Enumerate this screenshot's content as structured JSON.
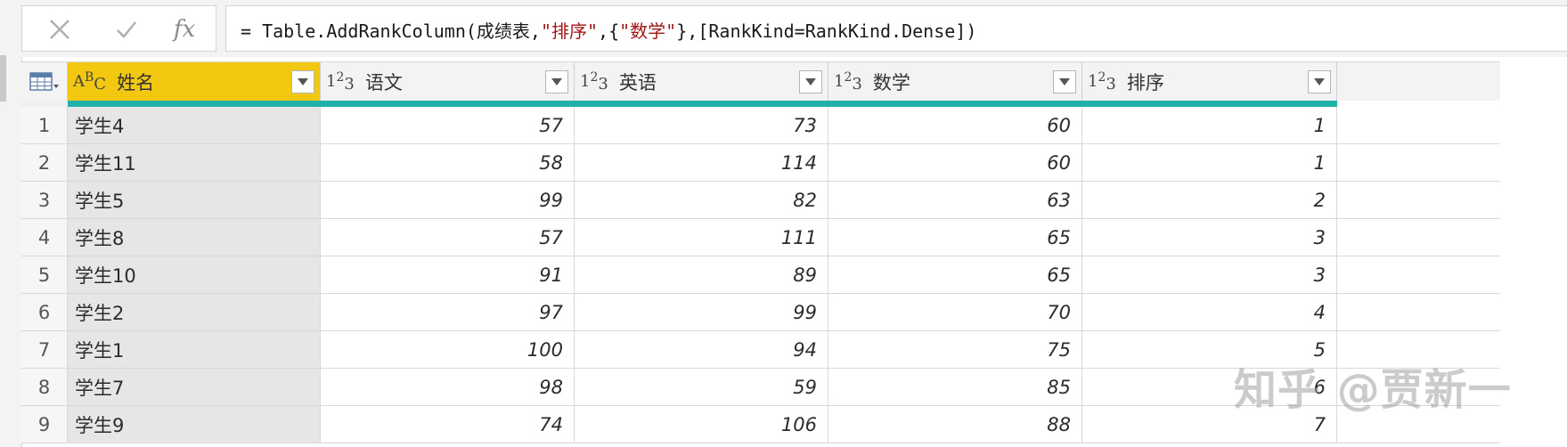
{
  "formula_bar": {
    "cancel_icon": "close-x",
    "commit_icon": "checkmark",
    "fx_label": "fx",
    "formula_prefix": "= Table.AddRankColumn(成绩表,",
    "formula_str1": "\"排序\"",
    "formula_mid": ",{",
    "formula_str2": "\"数学\"",
    "formula_suffix": "},[RankKind=RankKind.Dense])"
  },
  "table": {
    "columns": [
      {
        "label": "姓名",
        "type": "text"
      },
      {
        "label": "语文",
        "type": "number"
      },
      {
        "label": "英语",
        "type": "number"
      },
      {
        "label": "数学",
        "type": "number"
      },
      {
        "label": "排序",
        "type": "number"
      }
    ],
    "rows": [
      {
        "idx": "1",
        "name": "学生4",
        "yuwen": "57",
        "yingyu": "73",
        "shuxue": "60",
        "paixu": "1"
      },
      {
        "idx": "2",
        "name": "学生11",
        "yuwen": "58",
        "yingyu": "114",
        "shuxue": "60",
        "paixu": "1"
      },
      {
        "idx": "3",
        "name": "学生5",
        "yuwen": "99",
        "yingyu": "82",
        "shuxue": "63",
        "paixu": "2"
      },
      {
        "idx": "4",
        "name": "学生8",
        "yuwen": "57",
        "yingyu": "111",
        "shuxue": "65",
        "paixu": "3"
      },
      {
        "idx": "5",
        "name": "学生10",
        "yuwen": "91",
        "yingyu": "89",
        "shuxue": "65",
        "paixu": "3"
      },
      {
        "idx": "6",
        "name": "学生2",
        "yuwen": "97",
        "yingyu": "99",
        "shuxue": "70",
        "paixu": "4"
      },
      {
        "idx": "7",
        "name": "学生1",
        "yuwen": "100",
        "yingyu": "94",
        "shuxue": "75",
        "paixu": "5"
      },
      {
        "idx": "8",
        "name": "学生7",
        "yuwen": "98",
        "yingyu": "59",
        "shuxue": "85",
        "paixu": "6"
      },
      {
        "idx": "9",
        "name": "学生9",
        "yuwen": "74",
        "yingyu": "106",
        "shuxue": "88",
        "paixu": "7"
      }
    ]
  },
  "watermark": "知乎 @贾新一",
  "colors": {
    "selected_header": "#f2c811",
    "quality_bar": "#22b1a9",
    "string_literal": "#a31515"
  }
}
